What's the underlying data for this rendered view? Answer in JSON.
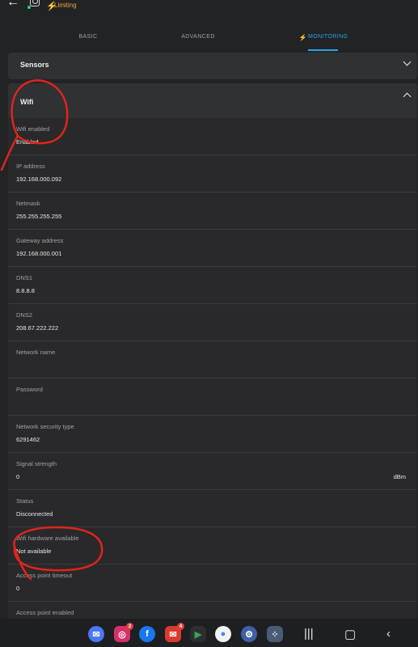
{
  "header": {
    "back_icon": "back-arrow-icon",
    "device_icon": "device-icon",
    "status_text": "Limiting",
    "status_color": "#f1a33a"
  },
  "tabs": [
    {
      "label": "BASIC",
      "active": false
    },
    {
      "label": "ADVANCED",
      "active": false
    },
    {
      "label": "MONITORING",
      "active": true
    }
  ],
  "sensors_panel": {
    "title": "Sensors",
    "expanded": false
  },
  "wifi_panel": {
    "title": "Wifi",
    "expanded": true,
    "fields": [
      {
        "label": "Wifi enabled",
        "value": "Enabled"
      },
      {
        "label": "IP address",
        "value": "192.168.000.092"
      },
      {
        "label": "Netmask",
        "value": "255.255.255.255"
      },
      {
        "label": "Gateway address",
        "value": "192.168.000.001"
      },
      {
        "label": "DNS1",
        "value": "8.8.8.8"
      },
      {
        "label": "DNS2",
        "value": "208.67.222.222"
      },
      {
        "label": "Network name",
        "value": ""
      },
      {
        "label": "Password",
        "value": ""
      },
      {
        "label": "Network security type",
        "value": "6291462"
      },
      {
        "label": "Signal strength",
        "value": "0",
        "unit": "dBm"
      },
      {
        "label": "Status",
        "value": "Disconnected"
      },
      {
        "label": "Wifi hardware available",
        "value": "Not available"
      },
      {
        "label": "Access point timeout",
        "value": "0"
      },
      {
        "label": "Access point enabled",
        "value": ""
      }
    ]
  },
  "dock": {
    "apps": [
      {
        "name": "messenger-icon",
        "color": "#4a78f5"
      },
      {
        "name": "instagram-icon",
        "color": "#d6306b",
        "badge": "2"
      },
      {
        "name": "facebook-icon",
        "color": "#1877f2"
      },
      {
        "name": "mail-icon",
        "color": "#d93b30",
        "badge": "4"
      },
      {
        "name": "play-store-icon",
        "color": "#2d2e30"
      },
      {
        "name": "chrome-icon",
        "color": "#f2f2f2"
      },
      {
        "name": "settings-icon",
        "color": "#3f5fa8"
      },
      {
        "name": "app-drawer-icon",
        "color": "#4a5b78"
      }
    ],
    "nav": [
      "recent-apps-icon",
      "home-icon",
      "back-icon"
    ]
  },
  "accent_color": "#28a6e0"
}
